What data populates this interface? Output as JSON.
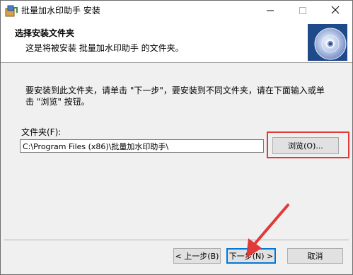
{
  "window": {
    "title": "批量加水印助手 安装",
    "app_icon": "installer-icon",
    "controls": {
      "minimize_icon": "minimize-icon",
      "maximize_icon": "maximize-icon",
      "close_icon": "close-icon"
    }
  },
  "header": {
    "title": "选择安装文件夹",
    "subtitle": "这是将被安装 批量加水印助手 的文件夹。",
    "graphic_icon": "cd-disc-icon"
  },
  "instructions": {
    "line1": "要安装到此文件夹，请单击 \"下一步\"，要安装到不同文件夹，请在下面输入或单",
    "line2": "击 \"浏览\" 按钮。"
  },
  "folder": {
    "label": "文件夹(F):",
    "value": "C:\\Program Files (x86)\\批量加水印助手\\",
    "browse_label": "浏览(O)..."
  },
  "footer": {
    "back_label": "< 上一步(B)",
    "next_label": "下一步(N) >",
    "cancel_label": "取消"
  },
  "colors": {
    "annotation_red": "#e03a3a",
    "focus_blue": "#0078d7",
    "header_bg": "#ffffff",
    "dialog_bg": "#f0f0f0"
  }
}
